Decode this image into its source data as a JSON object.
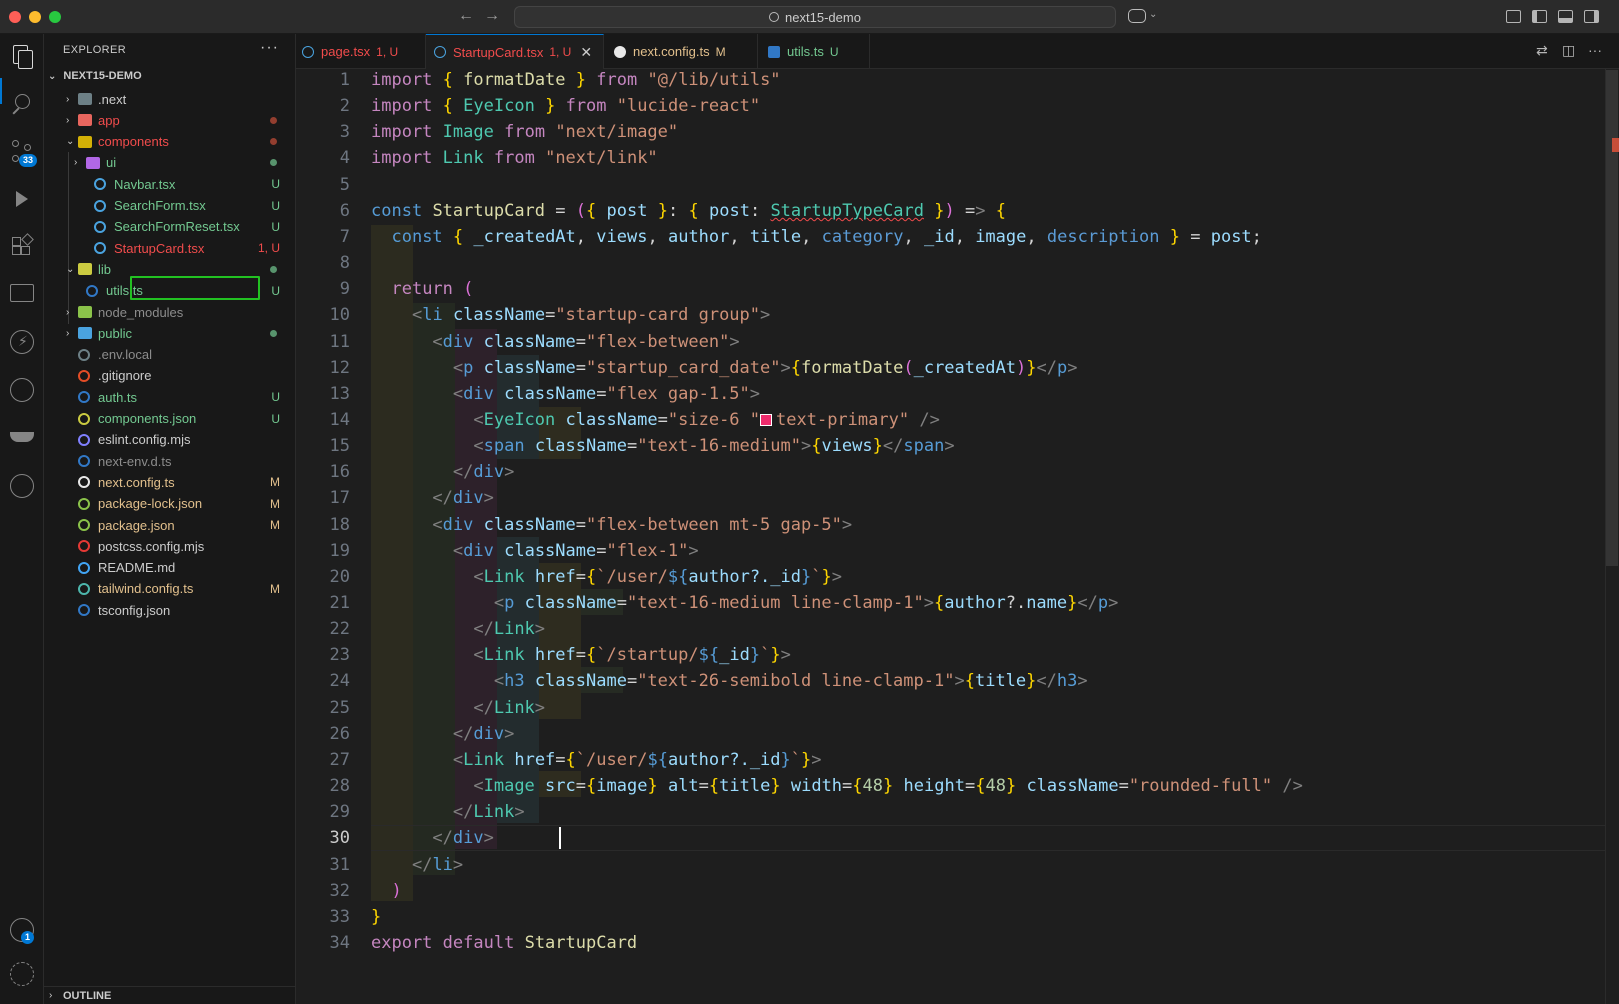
{
  "titlebar": {
    "search_text": "next15-demo",
    "back_arrow": "←",
    "forward_arrow": "→"
  },
  "activity_bar": {
    "scm_badge": "33",
    "accounts_badge": "1",
    "icons": [
      "files-icon",
      "search-icon",
      "source-control-icon",
      "run-debug-icon",
      "extensions-icon",
      "remote-explorer-icon",
      "lightning-icon",
      "git-graph-icon",
      "docker-icon",
      "timeline-icon",
      "accounts-icon",
      "settings-icon"
    ]
  },
  "sidebar": {
    "header": "EXPLORER",
    "more": "···",
    "root": "NEXT15-DEMO",
    "outline": "OUTLINE",
    "items": [
      {
        "label": ".next",
        "chev": "›",
        "color": "#cccccc",
        "status": "",
        "dot": ""
      },
      {
        "label": "app",
        "chev": "›",
        "color": "#f14c4c",
        "status": "",
        "dot": "#c74e39"
      },
      {
        "label": "components",
        "chev": "⌄",
        "color": "#f14c4c",
        "status": "",
        "dot": "#c74e39"
      },
      {
        "label": "ui",
        "chev": "›",
        "color": "#73c991",
        "status": "",
        "dot": "#73c991"
      },
      {
        "label": "Navbar.tsx",
        "chev": "",
        "color": "#73c991",
        "status": "U",
        "dot": ""
      },
      {
        "label": "SearchForm.tsx",
        "chev": "",
        "color": "#73c991",
        "status": "U",
        "dot": ""
      },
      {
        "label": "SearchFormReset.tsx",
        "chev": "",
        "color": "#73c991",
        "status": "U",
        "dot": ""
      },
      {
        "label": "StartupCard.tsx",
        "chev": "",
        "color": "#f14c4c",
        "status": "1, U",
        "dot": ""
      },
      {
        "label": "lib",
        "chev": "⌄",
        "color": "#73c991",
        "status": "",
        "dot": "#73c991"
      },
      {
        "label": "utils.ts",
        "chev": "",
        "color": "#73c991",
        "status": "U",
        "dot": ""
      },
      {
        "label": "node_modules",
        "chev": "›",
        "color": "#8c8c8c",
        "status": "",
        "dot": ""
      },
      {
        "label": "public",
        "chev": "›",
        "color": "#73c991",
        "status": "",
        "dot": "#73c991"
      },
      {
        "label": ".env.local",
        "chev": "",
        "color": "#8c8c8c",
        "status": "",
        "dot": ""
      },
      {
        "label": ".gitignore",
        "chev": "",
        "color": "#cccccc",
        "status": "",
        "dot": ""
      },
      {
        "label": "auth.ts",
        "chev": "",
        "color": "#73c991",
        "status": "U",
        "dot": ""
      },
      {
        "label": "components.json",
        "chev": "",
        "color": "#73c991",
        "status": "U",
        "dot": ""
      },
      {
        "label": "eslint.config.mjs",
        "chev": "",
        "color": "#cccccc",
        "status": "",
        "dot": ""
      },
      {
        "label": "next-env.d.ts",
        "chev": "",
        "color": "#8c8c8c",
        "status": "",
        "dot": ""
      },
      {
        "label": "next.config.ts",
        "chev": "",
        "color": "#e2c08d",
        "status": "M",
        "dot": ""
      },
      {
        "label": "package-lock.json",
        "chev": "",
        "color": "#e2c08d",
        "status": "M",
        "dot": ""
      },
      {
        "label": "package.json",
        "chev": "",
        "color": "#e2c08d",
        "status": "M",
        "dot": ""
      },
      {
        "label": "postcss.config.mjs",
        "chev": "",
        "color": "#cccccc",
        "status": "",
        "dot": ""
      },
      {
        "label": "README.md",
        "chev": "",
        "color": "#cccccc",
        "status": "",
        "dot": ""
      },
      {
        "label": "tailwind.config.ts",
        "chev": "",
        "color": "#e2c08d",
        "status": "M",
        "dot": ""
      },
      {
        "label": "tsconfig.json",
        "chev": "",
        "color": "#cccccc",
        "status": "",
        "dot": ""
      }
    ]
  },
  "tabs": [
    {
      "label": "page.tsx",
      "status": "1, U",
      "color": "#f14c4c",
      "active": false
    },
    {
      "label": "StartupCard.tsx",
      "status": "1, U",
      "color": "#f14c4c",
      "active": true,
      "close": "✕"
    },
    {
      "label": "next.config.ts",
      "status": "M",
      "color": "#e2c08d",
      "active": false
    },
    {
      "label": "utils.ts",
      "status": "U",
      "color": "#73c991",
      "active": false
    }
  ],
  "editor": {
    "current_line": 30,
    "line_numbers": [
      "1",
      "2",
      "3",
      "4",
      "5",
      "6",
      "7",
      "8",
      "9",
      "10",
      "11",
      "12",
      "13",
      "14",
      "15",
      "16",
      "17",
      "18",
      "19",
      "20",
      "21",
      "22",
      "23",
      "24",
      "25",
      "26",
      "27",
      "28",
      "29",
      "30",
      "31",
      "32",
      "33",
      "34"
    ],
    "lines": [
      "import { formatDate } from \"@/lib/utils\"",
      "import { EyeIcon } from \"lucide-react\"",
      "import Image from \"next/image\"",
      "import Link from \"next/link\"",
      "",
      "const StartupCard = ({ post }: { post: StartupTypeCard }) => {",
      "  const { _createdAt, views, author, title, category, _id, image, description } = post;",
      "",
      "  return (",
      "    <li className=\"startup-card group\">",
      "      <div className=\"flex-between\">",
      "        <p className=\"startup_card_date\">{formatDate(_createdAt)}</p>",
      "        <div className=\"flex gap-1.5\">",
      "          <EyeIcon className=\"size-6 text-primary\" />",
      "          <span className=\"text-16-medium\">{views}</span>",
      "        </div>",
      "      </div>",
      "      <div className=\"flex-between mt-5 gap-5\">",
      "        <div className=\"flex-1\">",
      "          <Link href={`/user/${author?._id}`}>",
      "            <p className=\"text-16-medium line-clamp-1\">{author?.name}</p>",
      "          </Link>",
      "          <Link href={`/startup/${_id}`}>",
      "            <h3 className=\"text-26-semibold line-clamp-1\">{title}</h3>",
      "          </Link>",
      "        </div>",
      "        <Link href={`/user/${author?._id}`}>",
      "          <Image src={image} alt={title} width={48} height={48} className=\"rounded-full\" />",
      "        </Link>",
      "      </div>",
      "    </li>",
      "  )",
      "}",
      "export default StartupCard"
    ]
  }
}
